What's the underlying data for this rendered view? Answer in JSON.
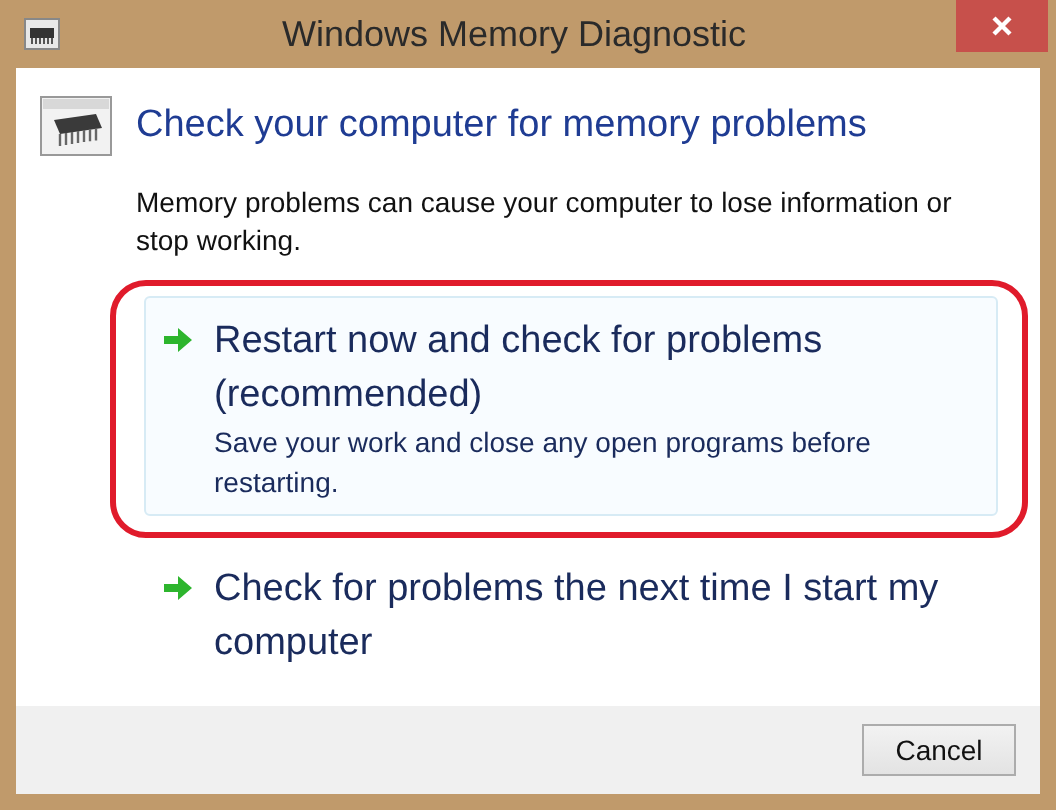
{
  "window": {
    "title": "Windows Memory Diagnostic"
  },
  "heading": "Check your computer for memory problems",
  "description": "Memory problems can cause your computer to lose information or stop working.",
  "options": [
    {
      "title": "Restart now and check for problems (recommended)",
      "subtitle": "Save your work and close any open programs before restarting.",
      "highlighted": true,
      "circled": true
    },
    {
      "title": "Check for problems the next time I start my computer",
      "highlighted": false,
      "circled": false
    }
  ],
  "buttons": [
    "Cancel"
  ]
}
